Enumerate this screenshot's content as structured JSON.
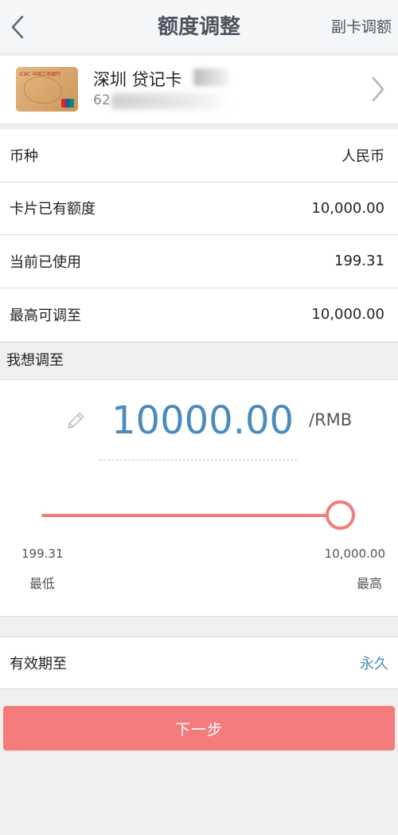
{
  "header": {
    "title": "额度调整",
    "right_action": "副卡调额"
  },
  "card": {
    "name": "深圳 贷记卡",
    "number_prefix": "62",
    "bank_text": "ICBC 中国工商银行"
  },
  "info": {
    "rows": [
      {
        "label": "币种",
        "value": "人民币"
      },
      {
        "label": "卡片已有额度",
        "value": "10,000.00"
      },
      {
        "label": "当前已使用",
        "value": "199.31"
      },
      {
        "label": "最高可调至",
        "value": "10,000.00"
      }
    ]
  },
  "adjust": {
    "section_title": "我想调至",
    "amount": "10000.00",
    "unit": "/RMB",
    "min_value": "199.31",
    "min_label": "最低",
    "max_value": "10,000.00",
    "max_label": "最高",
    "slider_fraction": 1.0
  },
  "expiry": {
    "label": "有效期至",
    "value": "永久"
  },
  "next_button": "下一步",
  "colors": {
    "accent_blue": "#4a8bbd",
    "accent_red": "#f47b7b"
  }
}
